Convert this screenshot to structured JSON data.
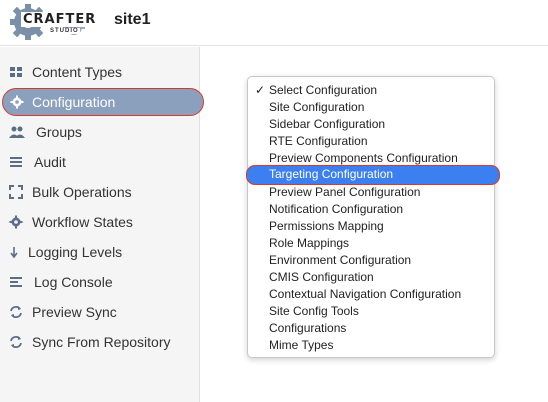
{
  "header": {
    "logo_text": "CRAFTER",
    "logo_sub": "STUDIO",
    "site_name": "site1"
  },
  "sidebar": {
    "items": [
      {
        "label": "Content Types",
        "icon": "grid-icon"
      },
      {
        "label": "Configuration",
        "icon": "gear-icon",
        "active": true
      },
      {
        "label": "Groups",
        "icon": "users-icon"
      },
      {
        "label": "Audit",
        "icon": "list-icon"
      },
      {
        "label": "Bulk Operations",
        "icon": "expand-icon"
      },
      {
        "label": "Workflow States",
        "icon": "gear-icon"
      },
      {
        "label": "Logging Levels",
        "icon": "arrow-down-icon"
      },
      {
        "label": "Log Console",
        "icon": "align-left-icon"
      },
      {
        "label": "Preview Sync",
        "icon": "refresh-icon"
      },
      {
        "label": "Sync From Repository",
        "icon": "refresh-icon"
      }
    ]
  },
  "dropdown": {
    "check_mark": "✓",
    "selected": "Select Configuration",
    "highlighted": "Targeting Configuration",
    "options": [
      "Select Configuration",
      "Site Configuration",
      "Sidebar Configuration",
      "RTE Configuration",
      "Preview Components Configuration",
      "Targeting Configuration",
      "Preview Panel Configuration",
      "Notification Configuration",
      "Permissions Mapping",
      "Role Mappings",
      "Environment Configuration",
      "CMIS Configuration",
      "Contextual Navigation Configuration",
      "Site Config Tools",
      "Configurations",
      "Mime Types"
    ]
  },
  "colors": {
    "active_bg": "#8aa0bd",
    "highlight_bg": "#3c7ff0",
    "annotation_outline": "#d83a2a"
  }
}
